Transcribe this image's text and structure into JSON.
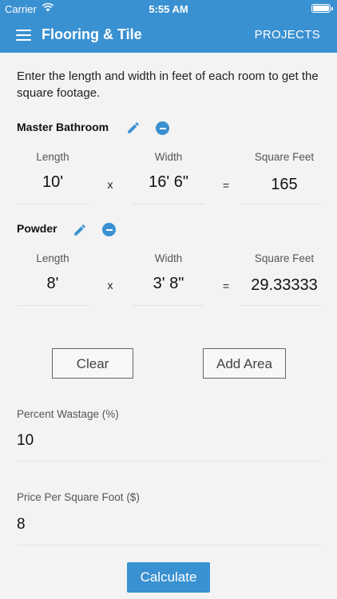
{
  "status_bar": {
    "carrier": "Carrier",
    "time": "5:55 AM"
  },
  "app_bar": {
    "title": "Flooring & Tile",
    "projects_label": "PROJECTS"
  },
  "intro_text": "Enter the length and width in feet of each room to get the square footage.",
  "columns": {
    "length": "Length",
    "width": "Width",
    "square_feet": "Square Feet"
  },
  "operators": {
    "times": "x",
    "equals": "="
  },
  "areas": [
    {
      "name": "Master Bathroom",
      "length": "10'",
      "width": "16' 6\"",
      "square_feet": "165"
    },
    {
      "name": "Powder",
      "length": "8'",
      "width": "3' 8\"",
      "square_feet": "29.33333"
    }
  ],
  "buttons": {
    "clear": "Clear",
    "add_area": "Add Area",
    "calculate": "Calculate"
  },
  "wastage": {
    "label": "Percent Wastage (%)",
    "value": "10"
  },
  "price": {
    "label": "Price Per Square Foot ($)",
    "value": "8"
  },
  "colors": {
    "primary": "#3a91d1",
    "background": "#f3f3f3"
  },
  "icons": [
    "menu-icon",
    "wifi-icon",
    "battery-icon",
    "edit-icon",
    "remove-icon"
  ]
}
